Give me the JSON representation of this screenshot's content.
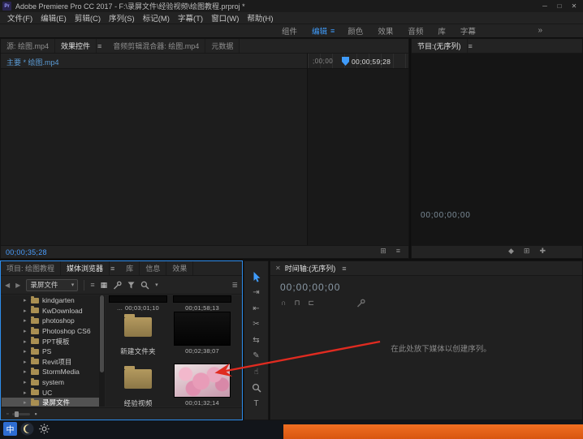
{
  "titlebar": {
    "app_badge": "Pr",
    "title": "Adobe Premiere Pro CC 2017 - F:\\录屏文件\\经验视频\\绘图教程.prproj *"
  },
  "menubar": {
    "items": [
      "文件(F)",
      "编辑(E)",
      "剪辑(C)",
      "序列(S)",
      "标记(M)",
      "字幕(T)",
      "窗口(W)",
      "帮助(H)"
    ]
  },
  "workspace": {
    "items": [
      "组件",
      "编辑",
      "颜色",
      "效果",
      "音频",
      "库",
      "字幕"
    ],
    "active": "编辑",
    "overflow": "»"
  },
  "source_panel": {
    "tabs": [
      {
        "label": "源: 绘图.mp4",
        "active": false
      },
      {
        "label": "效果控件",
        "active": true
      },
      {
        "label": "音频剪辑混合器: 绘图.mp4",
        "active": false
      },
      {
        "label": "元数据",
        "active": false
      }
    ],
    "clip_name": "主要 * 绘图.mp4",
    "ruler_label": ";00;00",
    "out_timecode": "00;00;59;28",
    "current_timecode": "00;00;35;28",
    "foot_icons": [
      "⊞",
      "≡"
    ]
  },
  "program_panel": {
    "title": "节目:(无序列)",
    "timecode": "00;00;00;00",
    "foot_icons": [
      "◆",
      "⊞",
      "✚"
    ]
  },
  "project_panel": {
    "tabs": [
      {
        "label": "项目: 绘图教程",
        "active": false
      },
      {
        "label": "媒体浏览器",
        "active": true
      },
      {
        "label": "库",
        "active": false
      },
      {
        "label": "信息",
        "active": false
      },
      {
        "label": "效果",
        "active": false
      }
    ],
    "location_dropdown": "录屏文件",
    "tree": [
      {
        "label": "kindgarten"
      },
      {
        "label": "KwDownload"
      },
      {
        "label": "photoshop"
      },
      {
        "label": "Photoshop CS6"
      },
      {
        "label": "PPT模板"
      },
      {
        "label": "PS"
      },
      {
        "label": "Revit项目"
      },
      {
        "label": "StormMedia"
      },
      {
        "label": "system"
      },
      {
        "label": "UC"
      },
      {
        "label": "录屏文件",
        "selected": true
      }
    ],
    "grid_items": [
      {
        "kind": "video",
        "name_ellipsis": "...",
        "timecode": "00;03;01;10"
      },
      {
        "kind": "video",
        "timecode": "00;01;58;13"
      },
      {
        "kind": "folder",
        "name": "新建文件夹"
      },
      {
        "kind": "video",
        "timecode": "00;02;38;07"
      },
      {
        "kind": "folder",
        "name": "经验视频"
      },
      {
        "kind": "video",
        "timecode": "00;01;32;14"
      }
    ]
  },
  "timeline_panel": {
    "title": "时间轴:(无序列)",
    "timecode": "00;00;00;00",
    "drop_hint": "在此处放下媒体以创建序列。",
    "toolbar_icons": [
      "∩",
      "⊓",
      "⊏"
    ]
  },
  "tools": {
    "items": [
      "selection",
      "track-select-forward",
      "ripple-edit",
      "razor",
      "slip",
      "pen",
      "hand",
      "zoom",
      "type"
    ]
  },
  "taskbar": {
    "ime_label": "中"
  },
  "icons": {
    "minimize": "─",
    "maximize": "□",
    "close": "✕",
    "panel_menu": "≡",
    "caret": "▾",
    "back": "◀",
    "forward": "▶",
    "list_view": "≡",
    "grid_view": "▦",
    "sort": "≣",
    "tree_expand": "▸",
    "thumb_small": "▫",
    "thumb_large": "▪"
  },
  "colors": {
    "accent_blue": "#3f9bfa",
    "timecode_blue": "#4a9eff",
    "taskbar_orange": "#e2631d",
    "arrow_red": "#e02b20"
  }
}
